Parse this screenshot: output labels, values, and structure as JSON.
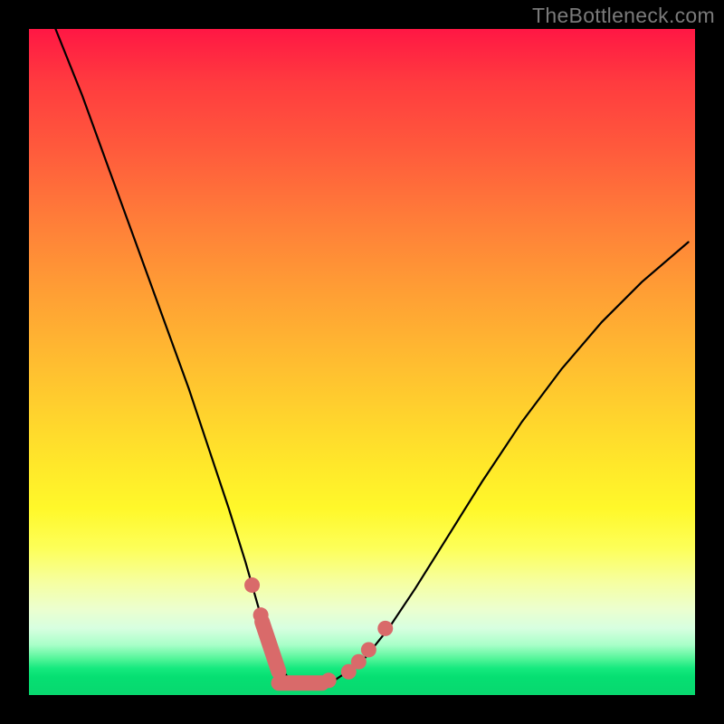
{
  "watermark": "TheBottleneck.com",
  "chart_data": {
    "type": "line",
    "title": "",
    "xlabel": "",
    "ylabel": "",
    "xlim": [
      0,
      100
    ],
    "ylim": [
      0,
      100
    ],
    "series": [
      {
        "name": "bottleneck-curve",
        "x": [
          4,
          8,
          12,
          16,
          20,
          24,
          27,
          30,
          32.5,
          34.5,
          36,
          37.5,
          39,
          41,
          43,
          46,
          50,
          54,
          58,
          63,
          68,
          74,
          80,
          86,
          92,
          99
        ],
        "values": [
          100,
          90,
          79,
          68,
          57,
          46,
          37,
          28,
          20,
          13,
          8,
          4.5,
          2.5,
          1.8,
          1.8,
          2.3,
          5,
          10,
          16,
          24,
          32,
          41,
          49,
          56,
          62,
          68
        ]
      }
    ],
    "markers": [
      {
        "x": 33.5,
        "y": 16.5
      },
      {
        "x": 34.8,
        "y": 12.0
      },
      {
        "x": 45.0,
        "y": 2.2
      },
      {
        "x": 48.0,
        "y": 3.5
      },
      {
        "x": 49.5,
        "y": 5.0
      },
      {
        "x": 51.0,
        "y": 6.8
      },
      {
        "x": 53.5,
        "y": 10.0
      }
    ],
    "flat_segment": {
      "x0": 37.5,
      "x1": 44.0,
      "y": 1.8
    },
    "left_segment": {
      "x0": 35.0,
      "y0": 11.0,
      "x1": 37.5,
      "y1": 3.5
    },
    "gradient_stops": [
      {
        "pct": 0,
        "color": "#ff1744"
      },
      {
        "pct": 50,
        "color": "#ffd32d"
      },
      {
        "pct": 78,
        "color": "#fdff59"
      },
      {
        "pct": 96,
        "color": "#15e97e"
      },
      {
        "pct": 100,
        "color": "#08d86f"
      }
    ]
  }
}
